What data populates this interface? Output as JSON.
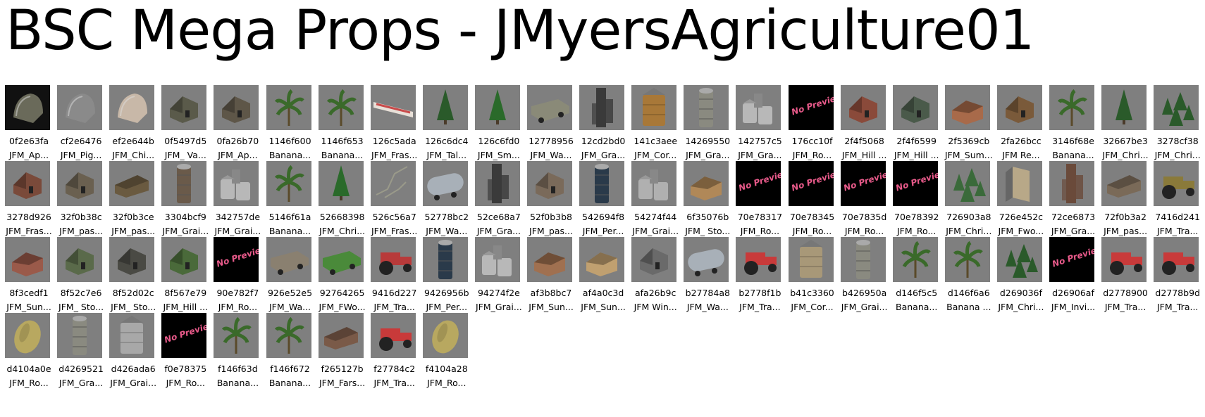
{
  "window": {
    "title": "BSC Mega Props - JMyersAgriculture01"
  },
  "no_preview_text": "No Preview",
  "items": [
    {
      "id": "0f2e63fa",
      "label": "JFM_Ap...",
      "icon": "barn-round-icon",
      "c": "#6a6a5a",
      "sel": true
    },
    {
      "id": "cf2e6476",
      "label": "JFM_Pig...",
      "icon": "barn-round-icon",
      "c": "#8a8a8a"
    },
    {
      "id": "ef2e644b",
      "label": "JFM_Chi...",
      "icon": "barn-round-icon",
      "c": "#c8b8a8"
    },
    {
      "id": "0f5497d5",
      "label": "JFM_ Va...",
      "icon": "barn-icon",
      "c": "#5a5a4a"
    },
    {
      "id": "0fa26b70",
      "label": "JFM_Ap...",
      "icon": "barn-icon",
      "c": "#5e5648"
    },
    {
      "id": "1146f600",
      "label": "Banana...",
      "icon": "palm-icon",
      "c": "#3a6a2a"
    },
    {
      "id": "1146f653",
      "label": "Banana...",
      "icon": "palm-icon",
      "c": "#3a6a2a"
    },
    {
      "id": "126c5ada",
      "label": "JFM_Fras...",
      "icon": "sign-icon",
      "c": "#c84a4a"
    },
    {
      "id": "126c6dc4",
      "label": "JFM_Tal...",
      "icon": "tree-icon",
      "c": "#2a5a2a"
    },
    {
      "id": "126c6fd0",
      "label": "JFM_Sm...",
      "icon": "tree-icon",
      "c": "#2a6a2a"
    },
    {
      "id": "12778956",
      "label": "JFM_Wa...",
      "icon": "wagon-icon",
      "c": "#8a8a78"
    },
    {
      "id": "12cd2bd0",
      "label": "JFM_Gra...",
      "icon": "elevator-icon",
      "c": "#3a3a3a"
    },
    {
      "id": "141c3aee",
      "label": "JFM_Cor...",
      "icon": "bin-icon",
      "c": "#a87838"
    },
    {
      "id": "14269550",
      "label": "JFM_Gra...",
      "icon": "silo-icon",
      "c": "#8a8a80"
    },
    {
      "id": "142757c5",
      "label": "JFM_Gra...",
      "icon": "bins-icon",
      "c": "#b8b8b8"
    },
    {
      "id": "176cc10f",
      "label": "JFM_Ro...",
      "icon": "no-preview-icon",
      "c": "#000000",
      "np": true
    },
    {
      "id": "2f4f5068",
      "label": "JFM_Hill ...",
      "icon": "barn-icon",
      "c": "#8a4a3a"
    },
    {
      "id": "2f4f6599",
      "label": "JFM_Hill ...",
      "icon": "barn-icon",
      "c": "#4a5a4a"
    },
    {
      "id": "2f5369cb",
      "label": "JFM_Sum...",
      "icon": "house-icon",
      "c": "#a86a4a"
    },
    {
      "id": "2fa26bcc",
      "label": "JFM Re...",
      "icon": "barn-icon",
      "c": "#7a5a3a"
    },
    {
      "id": "3146f68e",
      "label": "Banana...",
      "icon": "palm-icon",
      "c": "#3a6a2a"
    },
    {
      "id": "32667be3",
      "label": "JFM_Chri...",
      "icon": "tree-icon",
      "c": "#2a5a2a"
    },
    {
      "id": "3278cf38",
      "label": "JFM_Chri...",
      "icon": "trees-icon",
      "c": "#2a5a2a"
    },
    {
      "id": "3278d926",
      "label": "JFM_Fras...",
      "icon": "barn-icon",
      "c": "#7a4a3a"
    },
    {
      "id": "32f0b38c",
      "label": "JFM_pas...",
      "icon": "barn-icon",
      "c": "#6a6050"
    },
    {
      "id": "32f0b3ce",
      "label": "JFM_pas...",
      "icon": "shed-icon",
      "c": "#6a5a40"
    },
    {
      "id": "3304bcf9",
      "label": "JFM_Grai...",
      "icon": "silo-icon",
      "c": "#6a5a4a"
    },
    {
      "id": "342757de",
      "label": "JFM_Grai...",
      "icon": "bins-icon",
      "c": "#b8b8b8"
    },
    {
      "id": "5146f61a",
      "label": "Banana...",
      "icon": "palm-icon",
      "c": "#3a6a2a"
    },
    {
      "id": "52668398",
      "label": "JFM_Chri...",
      "icon": "tree-icon",
      "c": "#2a6a2a"
    },
    {
      "id": "526c56a7",
      "label": "JFM_Fras...",
      "icon": "fence-icon",
      "c": "#9a9a8a"
    },
    {
      "id": "52778bc2",
      "label": "JFM_Wa...",
      "icon": "tank-icon",
      "c": "#a8b0b8"
    },
    {
      "id": "52ce68a7",
      "label": "JFM_Gra...",
      "icon": "elevator-icon",
      "c": "#3a3a3a"
    },
    {
      "id": "52f0b3b8",
      "label": "JFM_pas...",
      "icon": "barn-icon",
      "c": "#7a6a5a"
    },
    {
      "id": "542694f8",
      "label": "JFM_Per...",
      "icon": "silo-icon",
      "c": "#2a3a4a"
    },
    {
      "id": "54274f44",
      "label": "JFM_Grai...",
      "icon": "bins-icon",
      "c": "#b0b0b0"
    },
    {
      "id": "6f35076b",
      "label": "JFM_ Sto...",
      "icon": "house-icon",
      "c": "#b08858"
    },
    {
      "id": "70e78317",
      "label": "JFM_Ro...",
      "icon": "no-preview-icon",
      "c": "#000000",
      "np": true
    },
    {
      "id": "70e78345",
      "label": "JFM_Ro...",
      "icon": "no-preview-icon",
      "c": "#000000",
      "np": true
    },
    {
      "id": "70e7835d",
      "label": "JFM_Ro...",
      "icon": "no-preview-icon",
      "c": "#000000",
      "np": true
    },
    {
      "id": "70e78392",
      "label": "JFM_Ro...",
      "icon": "no-preview-icon",
      "c": "#000000",
      "np": true
    },
    {
      "id": "726903a8",
      "label": "JFM_Chri...",
      "icon": "trees-icon",
      "c": "#3a6a3a"
    },
    {
      "id": "726e452c",
      "label": "JFM_Fwo...",
      "icon": "crate-icon",
      "c": "#b8a888"
    },
    {
      "id": "72ce6873",
      "label": "JFM_Gra...",
      "icon": "elevator-icon",
      "c": "#6a4a3a"
    },
    {
      "id": "72f0b3a2",
      "label": "JFM_pas...",
      "icon": "shed-icon",
      "c": "#7a6a58"
    },
    {
      "id": "7416d241",
      "label": "JFM_Tra...",
      "icon": "tractor-icon",
      "c": "#8a7a3a"
    },
    {
      "id": "8f3cedf1",
      "label": "JFM_Sun...",
      "icon": "house-icon",
      "c": "#9a5a4a"
    },
    {
      "id": "8f52c7e6",
      "label": "JFM_ Sto...",
      "icon": "barn-icon",
      "c": "#5a6a4a"
    },
    {
      "id": "8f52d02c",
      "label": "JFM_ Sto...",
      "icon": "barn-icon",
      "c": "#4a4a44"
    },
    {
      "id": "8f567e79",
      "label": "JFM_Hill ...",
      "icon": "barn-icon",
      "c": "#4a6a3a"
    },
    {
      "id": "90e782f7",
      "label": "JFM_Ro...",
      "icon": "no-preview-icon",
      "c": "#000000",
      "np": true
    },
    {
      "id": "926e52e5",
      "label": "JFM_Wa...",
      "icon": "wagon-icon",
      "c": "#8a8070"
    },
    {
      "id": "92764265",
      "label": "JFM_FWo...",
      "icon": "wagon-icon",
      "c": "#4a8a3a"
    },
    {
      "id": "9416d227",
      "label": "JFM_Tra...",
      "icon": "tractor-icon",
      "c": "#b83a3a"
    },
    {
      "id": "9426956b",
      "label": "JFM_Per...",
      "icon": "silo-icon",
      "c": "#2a3a4a"
    },
    {
      "id": "94274f2e",
      "label": "JFM_Grai...",
      "icon": "bins-icon",
      "c": "#b8b8b8"
    },
    {
      "id": "af3b8bc7",
      "label": "JFM_Sun...",
      "icon": "house-icon",
      "c": "#a07050"
    },
    {
      "id": "af4a0c3d",
      "label": "JFM_Sun...",
      "icon": "house-icon",
      "c": "#c0a070"
    },
    {
      "id": "afa26b9c",
      "label": "JFM Win...",
      "icon": "barn-icon",
      "c": "#6a6a6a"
    },
    {
      "id": "b27784a8",
      "label": "JFM_Wa...",
      "icon": "tank-icon",
      "c": "#a8b0b8"
    },
    {
      "id": "b2778f1b",
      "label": "JFM_Tra...",
      "icon": "tractor-icon",
      "c": "#c83a3a"
    },
    {
      "id": "b41c3360",
      "label": "JFM_Cor...",
      "icon": "bin-icon",
      "c": "#a89878"
    },
    {
      "id": "b426950a",
      "label": "JFM_Grai...",
      "icon": "silo-icon",
      "c": "#8a8a80"
    },
    {
      "id": "d146f5c5",
      "label": "Banana...",
      "icon": "palm-icon",
      "c": "#3a6a2a"
    },
    {
      "id": "d146f6a6",
      "label": "Banana ...",
      "icon": "palm-icon",
      "c": "#3a6a2a"
    },
    {
      "id": "d269036f",
      "label": "JFM_Chri...",
      "icon": "trees-icon",
      "c": "#2a5a2a"
    },
    {
      "id": "d26906af",
      "label": "JFM_Invi...",
      "icon": "no-preview-icon",
      "c": "#000000",
      "np": true
    },
    {
      "id": "d2778900",
      "label": "JFM_Tra...",
      "icon": "tractor-icon",
      "c": "#c83a3a"
    },
    {
      "id": "d2778b9d",
      "label": "JFM_Tra...",
      "icon": "tractor-icon",
      "c": "#c83a3a"
    },
    {
      "id": "d4104a0e",
      "label": "JFM_Ro...",
      "icon": "bale-icon",
      "c": "#b8a860"
    },
    {
      "id": "d4269521",
      "label": "JFM_Gra...",
      "icon": "silo-icon",
      "c": "#8a8a80"
    },
    {
      "id": "d426ada6",
      "label": "JFM_Grai...",
      "icon": "bin-icon",
      "c": "#a8a8a8"
    },
    {
      "id": "f0e78375",
      "label": "JFM_Ro...",
      "icon": "no-preview-icon",
      "c": "#000000",
      "np": true
    },
    {
      "id": "f146f63d",
      "label": "Banana...",
      "icon": "palm-icon",
      "c": "#3a6a2a"
    },
    {
      "id": "f146f672",
      "label": "Banana...",
      "icon": "palm-icon",
      "c": "#3a6a2a"
    },
    {
      "id": "f265127b",
      "label": "JFM_Fars...",
      "icon": "shed-icon",
      "c": "#7a5a48"
    },
    {
      "id": "f27784c2",
      "label": "JFM_Tra...",
      "icon": "tractor-icon",
      "c": "#c83a3a"
    },
    {
      "id": "f4104a28",
      "label": "JFM_Ro...",
      "icon": "bale-icon",
      "c": "#b8a860"
    }
  ]
}
